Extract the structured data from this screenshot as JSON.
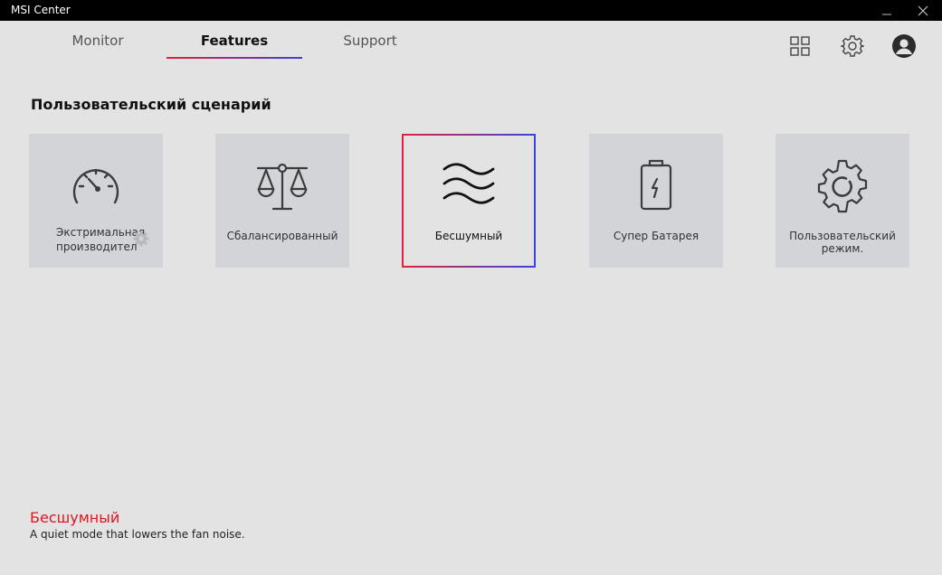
{
  "window": {
    "title": "MSI Center"
  },
  "tabs": [
    {
      "label": "Monitor",
      "active": false
    },
    {
      "label": "Features",
      "active": true
    },
    {
      "label": "Support",
      "active": false
    }
  ],
  "section": {
    "title": "Пользовательский сценарий"
  },
  "cards": [
    {
      "label": "Экстримальная производител",
      "icon": "speedometer-icon",
      "has_settings": true
    },
    {
      "label": "Сбалансированный",
      "icon": "scale-icon"
    },
    {
      "label": "Бесшумный",
      "icon": "silent-waves-icon",
      "selected": true
    },
    {
      "label": "Супер Батарея",
      "icon": "battery-icon"
    },
    {
      "label": "Пользовательский режим.",
      "icon": "gear-icon"
    }
  ],
  "description": {
    "title": "Бесшумный",
    "text": "A quiet mode that lowers the fan noise."
  },
  "colors": {
    "accent_red": "#e2223b",
    "accent_blue": "#3b44d9",
    "description_title": "#e1141f"
  }
}
